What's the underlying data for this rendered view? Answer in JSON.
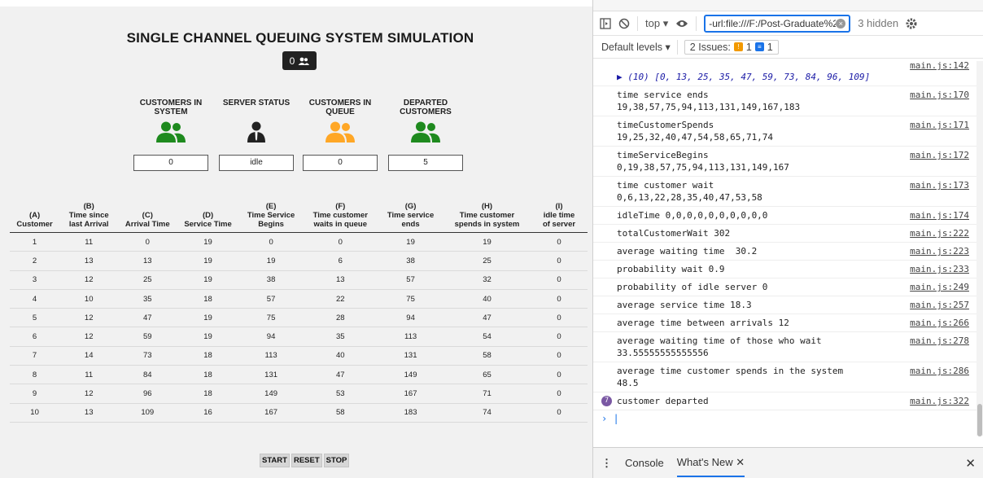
{
  "app": {
    "title": "SINGLE CHANNEL QUEUING SYSTEM SIMULATION",
    "customer_count": "0",
    "stats": [
      {
        "label": "CUSTOMERS IN SYSTEM",
        "value": "0",
        "icon": "users-icon",
        "color": "#1e8a1e"
      },
      {
        "label": "SERVER STATUS",
        "value": "idle",
        "icon": "user-tie-icon",
        "color": "#222222"
      },
      {
        "label": "CUSTOMERS IN QUEUE",
        "value": "0",
        "icon": "users-icon",
        "color": "#ffa726"
      },
      {
        "label": "DEPARTED CUSTOMERS",
        "value": "5",
        "icon": "users-icon",
        "color": "#1e8a1e"
      }
    ],
    "table": {
      "headers": [
        [
          "(A)",
          "Customer"
        ],
        [
          "(B)",
          "Time since",
          "last Arrival"
        ],
        [
          "(C)",
          "Arrival Time"
        ],
        [
          "(D)",
          "Service Time"
        ],
        [
          "(E)",
          "Time Service",
          "Begins"
        ],
        [
          "(F)",
          "Time customer",
          "waits in queue"
        ],
        [
          "(G)",
          "Time service",
          "ends"
        ],
        [
          "(H)",
          "Time customer",
          "spends in system"
        ],
        [
          "(I)",
          "idle time",
          "of server"
        ]
      ],
      "rows": [
        [
          "1",
          "11",
          "0",
          "19",
          "0",
          "0",
          "19",
          "19",
          "0"
        ],
        [
          "2",
          "13",
          "13",
          "19",
          "19",
          "6",
          "38",
          "25",
          "0"
        ],
        [
          "3",
          "12",
          "25",
          "19",
          "38",
          "13",
          "57",
          "32",
          "0"
        ],
        [
          "4",
          "10",
          "35",
          "18",
          "57",
          "22",
          "75",
          "40",
          "0"
        ],
        [
          "5",
          "12",
          "47",
          "19",
          "75",
          "28",
          "94",
          "47",
          "0"
        ],
        [
          "6",
          "12",
          "59",
          "19",
          "94",
          "35",
          "113",
          "54",
          "0"
        ],
        [
          "7",
          "14",
          "73",
          "18",
          "113",
          "40",
          "131",
          "58",
          "0"
        ],
        [
          "8",
          "11",
          "84",
          "18",
          "131",
          "47",
          "149",
          "65",
          "0"
        ],
        [
          "9",
          "12",
          "96",
          "18",
          "149",
          "53",
          "167",
          "71",
          "0"
        ],
        [
          "10",
          "13",
          "109",
          "16",
          "167",
          "58",
          "183",
          "74",
          "0"
        ]
      ]
    },
    "buttons": {
      "start": "START",
      "reset": "RESET",
      "stop": "STOP"
    }
  },
  "devtools": {
    "context": "top",
    "filter_value": "-url:file:///F:/Post-Graduate%20I",
    "hidden": "3 hidden",
    "levels": "Default levels",
    "issues_label": "2 Issues:",
    "issues_warn": "1",
    "issues_info": "1",
    "messages": [
      {
        "text": "▶ (10) [0, 13, 25, 35, 47, 59, 73, 84, 96, 109]",
        "src": "main.js:142",
        "kind": "arr"
      },
      {
        "text": "time service ends\n19,38,57,75,94,113,131,149,167,183",
        "src": "main.js:170"
      },
      {
        "text": "timeCustomerSpends\n19,25,32,40,47,54,58,65,71,74",
        "src": "main.js:171"
      },
      {
        "text": "timeServiceBegins\n0,19,38,57,75,94,113,131,149,167",
        "src": "main.js:172"
      },
      {
        "text": "time customer wait\n0,6,13,22,28,35,40,47,53,58",
        "src": "main.js:173"
      },
      {
        "text": "idleTime 0,0,0,0,0,0,0,0,0,0",
        "src": "main.js:174"
      },
      {
        "text": "totalCustomerWait 302",
        "src": "main.js:222"
      },
      {
        "text": "average waiting time  30.2",
        "src": "main.js:223"
      },
      {
        "text": "probability wait 0.9",
        "src": "main.js:233"
      },
      {
        "text": "probability of idle server 0",
        "src": "main.js:249"
      },
      {
        "text": "average service time 18.3",
        "src": "main.js:257"
      },
      {
        "text": "average time between arrivals 12",
        "src": "main.js:266"
      },
      {
        "text": "average waiting time of those who wait\n33.55555555555556",
        "src": "main.js:278"
      },
      {
        "text": "average time customer spends in the system\n48.5",
        "src": "main.js:286"
      },
      {
        "text": "customer departed",
        "src": "main.js:322",
        "count": "7"
      }
    ],
    "drawer_tabs": [
      "Console",
      "What's New"
    ]
  }
}
